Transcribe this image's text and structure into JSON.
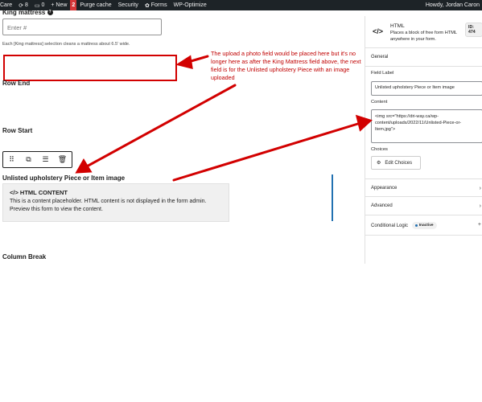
{
  "adminbar": {
    "site": "Care",
    "updates_count": "8",
    "comments_count": "0",
    "new_label": "+ New",
    "notif_badge": "2",
    "purge_label": "Purge cache",
    "security_label": "Security",
    "forms_label": "Forms",
    "wpoptimize_label": "WP-Optimize",
    "howdy": "Howdy, Jordan Caron"
  },
  "editor": {
    "king_label": "King mattress",
    "king_placeholder": "Enter #",
    "king_help": "Each [King mattress] selection cleans a mattress about 6.5' wide.",
    "row_end": "Row End",
    "row_start": "Row Start",
    "field_label": "Unlisted upholstery Piece or Item image",
    "placeholder_title": "</> HTML CONTENT",
    "placeholder_text": "This is a content placeholder. HTML content is not displayed in the form admin. Preview this form to view the content.",
    "column_break": "Column Break"
  },
  "annotation": {
    "text": "The upload a photo field would be placed here but it's no longer here as after the King Mattress field above, the next field is for the Unlisted upholstery Piece with an image uploaded",
    "color": "#d20000"
  },
  "sidebar": {
    "icon": "</>",
    "title": "HTML",
    "description": "Places a block of free form HTML anywhere in your form.",
    "id_badge": "ID: 474",
    "general": "General",
    "field_label_heading": "Field Label",
    "field_label_value": "Unlisted upholstery Piece or Item image",
    "content_heading": "Content",
    "content_value": "<img src=\"https://dri-way.ca/wp-content/uploads/2022/11/Unlisted-Piece-or-Item.jpg\">",
    "choices_heading": "Choices",
    "edit_choices": "Edit Choices",
    "appearance": "Appearance",
    "advanced": "Advanced",
    "conditional_logic": "Conditional Logic",
    "inactive": "Inactive"
  },
  "colors": {
    "admin_bar": "#1d2327",
    "accent_blue": "#2271b1",
    "annotation_red": "#d20000"
  }
}
